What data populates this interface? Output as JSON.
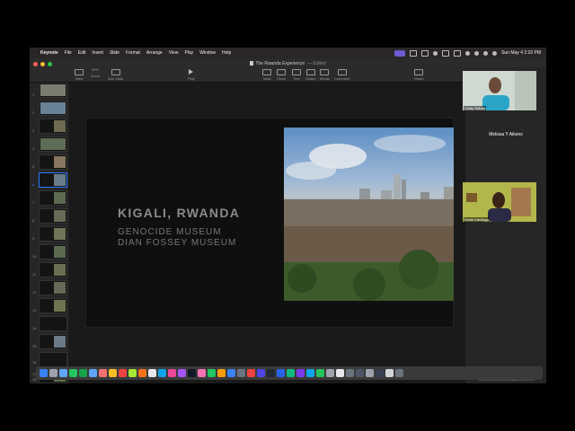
{
  "menubar": {
    "items": [
      "Keynote",
      "File",
      "Edit",
      "Insert",
      "Slide",
      "Format",
      "Arrange",
      "View",
      "Play",
      "Window",
      "Help"
    ],
    "clock": "Sun May 4  2:20 PM"
  },
  "window": {
    "title": "The Rwanda Experience",
    "edited": "— Edited"
  },
  "toolbar": {
    "view_label": "View",
    "zoom_value": "50%",
    "zoom_label": "Zoom",
    "add_slide_label": "Add Slide",
    "play_label": "Play",
    "table_label": "Table",
    "chart_label": "Chart",
    "text_label": "Text",
    "shape_label": "Shape",
    "media_label": "Media",
    "comment_label": "Comment",
    "share_label": "Share"
  },
  "slide_navigator": {
    "slide_numbers": [
      "1",
      "2",
      "3",
      "4",
      "5",
      "6",
      "7",
      "8",
      "9",
      "10",
      "11",
      "12",
      "13",
      "14",
      "15",
      "16",
      "17",
      "18"
    ],
    "selected_index": 5
  },
  "slide": {
    "title": "KIGALI, RWANDA",
    "line1": "GENOCIDE MUSEUM",
    "line2": "DIAN FOSSEY MUSEUM"
  },
  "edit_layout_label": "Edit Slide Layout",
  "participants": {
    "top_name": "Cindy Tolbert",
    "middle_name": "Melissa Y Aikens",
    "bottom_name": "Estrie Kantiogo"
  },
  "colors": {
    "accent": "#2a7cff",
    "close": "#ff5f57",
    "minimize": "#febc2e",
    "maximize": "#28c840"
  }
}
